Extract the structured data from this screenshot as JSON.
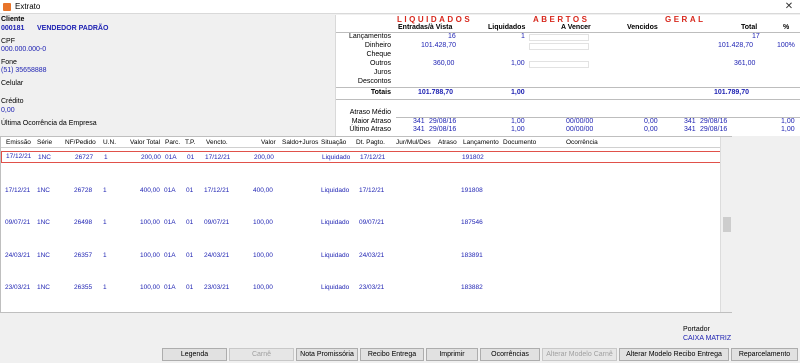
{
  "window": {
    "title": "Extrato",
    "close_glyph": "✕"
  },
  "client": {
    "label": "Cliente",
    "code": "000181",
    "name": "VENDEDOR PADRÃO",
    "cpf_label": "CPF",
    "cpf_value": "000.000.000-0",
    "fone_label": "Fone",
    "fone_value": "(51) 35658888",
    "celular_label": "Celular",
    "credito_label": "Crédito",
    "credito_value": "0,00",
    "ocorrencia_label": "Última Ocorrência da Empresa"
  },
  "summary": {
    "liquidados": {
      "title": "LIQUIDADOS",
      "col1": "Entradas/à Vista",
      "col2": "Liquidados"
    },
    "abertos": {
      "title": "ABERTOS",
      "col1": "A Vencer",
      "col2": "Vencidos"
    },
    "geral": {
      "title": "GERAL",
      "col1": "Total",
      "col2": "%"
    },
    "rows": {
      "lancamentos": "Lançamentos",
      "dinheiro": "Dinheiro",
      "cheque": "Cheque",
      "outros": "Outros",
      "juros": "Juros",
      "descontos": "Descontos",
      "totais": "Totais",
      "atraso_medio": "Atraso Médio",
      "maior_atraso": "Maior Atraso",
      "ultimo_atraso": "Último Atraso"
    },
    "values": {
      "lanc_liq_entr": "16",
      "lanc_liq": "1",
      "lanc_total": "17",
      "din_liq_entr": "101.428,70",
      "din_total": "101.428,70",
      "din_pct": "100%",
      "out_liq_entr": "360,00",
      "out_liq": "1,00",
      "out_total": "361,00",
      "tot_liq_entr": "101.788,70",
      "tot_liq": "1,00",
      "tot_total": "101.789,70",
      "maior_liq_days": "341",
      "maior_liq_date": "29/08/16",
      "maior_liq_val": "1,00",
      "maior_aber_date": "00/00/00",
      "maior_aber_val": "0,00",
      "maior_ger_days": "341",
      "maior_ger_date": "29/08/16",
      "maior_ger_val": "1,00",
      "ult_liq_days": "341",
      "ult_liq_date": "29/08/16",
      "ult_liq_val": "1,00",
      "ult_aber_date": "00/00/00",
      "ult_aber_val": "0,00",
      "ult_ger_days": "341",
      "ult_ger_date": "29/08/16",
      "ult_ger_val": "1,00"
    }
  },
  "grid": {
    "columns": [
      "Emissão",
      "Série",
      "NF/Pedido",
      "U.N.",
      "Valor Total",
      "Parc.",
      "T.P.",
      "Vencto.",
      "Valor",
      "Saldo+Juros",
      "Situação",
      "Dt. Pagto.",
      "Jur/Mul/Des",
      "Atraso",
      "Lançamento",
      "Documento",
      "Ocorrência"
    ],
    "rows": [
      [
        "17/12/21",
        "1NC",
        "26727",
        "1",
        "200,00",
        "01A",
        "01",
        "17/12/21",
        "200,00",
        "",
        "Liquidado",
        "17/12/21",
        "",
        "",
        "191802",
        "",
        ""
      ],
      [
        "17/12/21",
        "1NC",
        "26728",
        "1",
        "400,00",
        "01A",
        "01",
        "17/12/21",
        "400,00",
        "",
        "Liquidado",
        "17/12/21",
        "",
        "",
        "191808",
        "",
        ""
      ],
      [
        "09/07/21",
        "1NC",
        "26498",
        "1",
        "100,00",
        "01A",
        "01",
        "09/07/21",
        "100,00",
        "",
        "Liquidado",
        "09/07/21",
        "",
        "",
        "187546",
        "",
        ""
      ],
      [
        "24/03/21",
        "1NC",
        "26357",
        "1",
        "100,00",
        "01A",
        "01",
        "24/03/21",
        "100,00",
        "",
        "Liquidado",
        "24/03/21",
        "",
        "",
        "183891",
        "",
        ""
      ],
      [
        "23/03/21",
        "1NC",
        "26355",
        "1",
        "100,00",
        "01A",
        "01",
        "23/03/21",
        "100,00",
        "",
        "Liquidado",
        "23/03/21",
        "",
        "",
        "183882",
        "",
        ""
      ]
    ]
  },
  "portador": {
    "label": "Portador",
    "value": "CAIXA MATRIZ"
  },
  "buttons": {
    "legenda": "Legenda",
    "carne": "Carnê",
    "nota": "Nota Promissória",
    "recibo": "Recibo Entrega",
    "imprimir": "Imprimir",
    "ocorrencias": "Ocorrências",
    "alterar_carne": "Alterar Modelo Carnê",
    "alterar_recibo": "Alterar Modelo Recibo Entrega",
    "reparcelamento": "Reparcelamento"
  }
}
